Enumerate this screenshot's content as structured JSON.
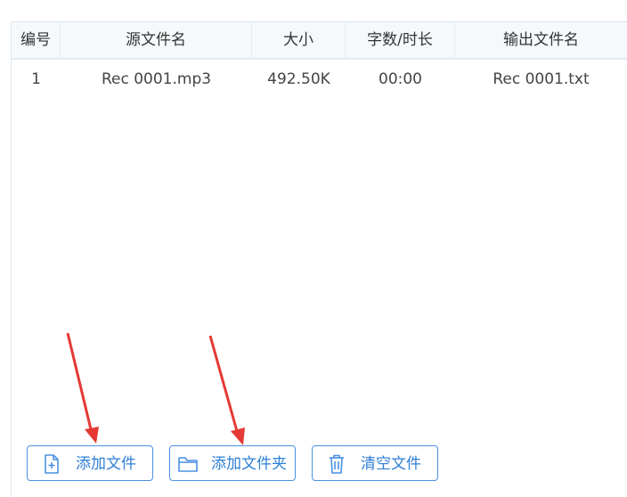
{
  "table": {
    "columns": [
      "编号",
      "源文件名",
      "大小",
      "字数/时长",
      "输出文件名"
    ],
    "rows": [
      {
        "index": "1",
        "source": "Rec 0001.mp3",
        "size": "492.50K",
        "duration": "00:00",
        "output": "Rec 0001.txt"
      }
    ]
  },
  "actions": {
    "add_file": "添加文件",
    "add_folder": "添加文件夹",
    "clear_files": "清空文件"
  },
  "icons": {
    "add_file": "file-plus-icon",
    "add_folder": "folder-icon",
    "clear_files": "trash-icon"
  },
  "colors": {
    "accent": "#4a90e2",
    "annotation_arrow": "#e53935"
  }
}
